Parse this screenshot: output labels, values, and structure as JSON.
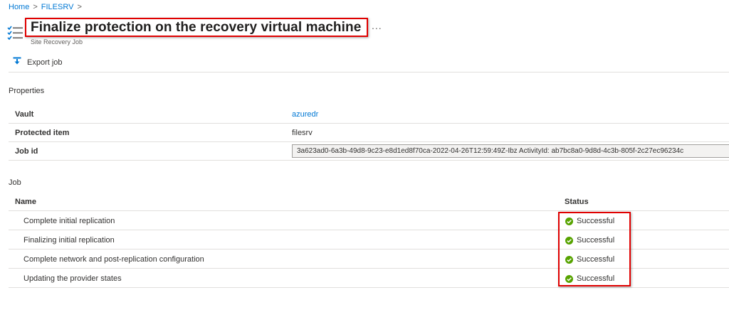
{
  "breadcrumb": [
    {
      "label": "Home"
    },
    {
      "label": "FILESRV"
    }
  ],
  "breadcrumb_separator": ">",
  "header": {
    "title": "Finalize protection on the recovery virtual machine",
    "subtitle": "Site Recovery Job",
    "more_label": "...",
    "icon": "job-list-icon"
  },
  "toolbar": {
    "export_label": "Export job",
    "export_icon": "download-icon"
  },
  "properties": {
    "section_label": "Properties",
    "rows": [
      {
        "key": "Vault",
        "value": "azuredr"
      },
      {
        "key": "Protected item",
        "value": "filesrv"
      },
      {
        "key": "Job id",
        "value": "3a623ad0-6a3b-49d8-9c23-e8d1ed8f70ca-2022-04-26T12:59:49Z-Ibz ActivityId: ab7bc8a0-9d8d-4c3b-805f-2c27ec96234c"
      }
    ]
  },
  "job": {
    "section_label": "Job",
    "columns": {
      "name": "Name",
      "status": "Status"
    },
    "rows": [
      {
        "name": "Complete initial replication",
        "status": "Successful"
      },
      {
        "name": "Finalizing initial replication",
        "status": "Successful"
      },
      {
        "name": "Complete network and post-replication configuration",
        "status": "Successful"
      },
      {
        "name": "Updating the provider states",
        "status": "Successful"
      }
    ]
  },
  "colors": {
    "link": "#0078d4",
    "success": "#57a300",
    "highlight": "#e00000"
  }
}
